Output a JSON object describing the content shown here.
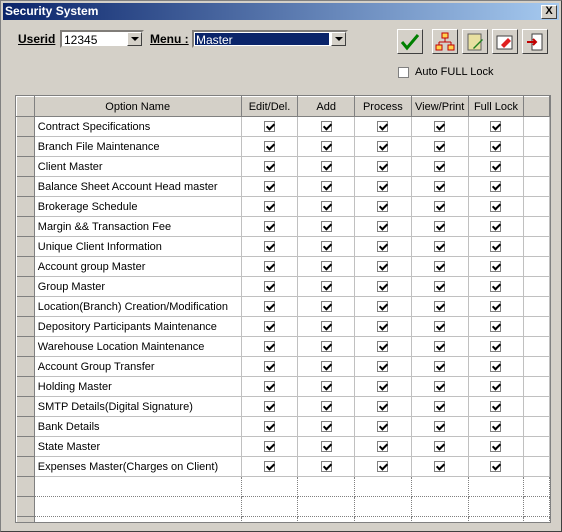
{
  "window": {
    "title": "Security System",
    "close_label": "X"
  },
  "form": {
    "userid_label": "Userid",
    "userid_value": "12345",
    "menu_label": "Menu :",
    "menu_value": "Master",
    "auto_full_lock_label": "Auto FULL Lock",
    "auto_full_lock_checked": false
  },
  "toolbar": {
    "buttons": [
      {
        "icon": "checkmark-icon"
      },
      {
        "icon": "hierarchy-icon"
      },
      {
        "icon": "edit-note-icon"
      },
      {
        "icon": "erase-icon"
      },
      {
        "icon": "exit-icon"
      }
    ]
  },
  "table": {
    "columns": [
      "Option Name",
      "Edit/Del.",
      "Add",
      "Process",
      "View/Print",
      "Full Lock"
    ],
    "rows": [
      {
        "name": "Contract Specifications",
        "edit": true,
        "add": true,
        "process": true,
        "view": true,
        "full": true
      },
      {
        "name": "Branch File Maintenance",
        "edit": true,
        "add": true,
        "process": true,
        "view": true,
        "full": true
      },
      {
        "name": "Client Master",
        "edit": true,
        "add": true,
        "process": true,
        "view": true,
        "full": true
      },
      {
        "name": "Balance Sheet Account Head master",
        "edit": true,
        "add": true,
        "process": true,
        "view": true,
        "full": true
      },
      {
        "name": "Brokerage Schedule",
        "edit": true,
        "add": true,
        "process": true,
        "view": true,
        "full": true
      },
      {
        "name": "Margin && Transaction Fee",
        "edit": true,
        "add": true,
        "process": true,
        "view": true,
        "full": true
      },
      {
        "name": "Unique Client Information",
        "edit": true,
        "add": true,
        "process": true,
        "view": true,
        "full": true
      },
      {
        "name": "Account group Master",
        "edit": true,
        "add": true,
        "process": true,
        "view": true,
        "full": true
      },
      {
        "name": "Group Master",
        "edit": true,
        "add": true,
        "process": true,
        "view": true,
        "full": true
      },
      {
        "name": "Location(Branch) Creation/Modification",
        "edit": true,
        "add": true,
        "process": true,
        "view": true,
        "full": true
      },
      {
        "name": "Depository Participants Maintenance",
        "edit": true,
        "add": true,
        "process": true,
        "view": true,
        "full": true
      },
      {
        "name": "Warehouse Location Maintenance",
        "edit": true,
        "add": true,
        "process": true,
        "view": true,
        "full": true
      },
      {
        "name": "Account Group Transfer",
        "edit": true,
        "add": true,
        "process": true,
        "view": true,
        "full": true
      },
      {
        "name": "Holding Master",
        "edit": true,
        "add": true,
        "process": true,
        "view": true,
        "full": true
      },
      {
        "name": "SMTP Details(Digital Signature)",
        "edit": true,
        "add": true,
        "process": true,
        "view": true,
        "full": true
      },
      {
        "name": "Bank Details",
        "edit": true,
        "add": true,
        "process": true,
        "view": true,
        "full": true
      },
      {
        "name": "State Master",
        "edit": true,
        "add": true,
        "process": true,
        "view": true,
        "full": true
      },
      {
        "name": "Expenses Master(Charges on Client)",
        "edit": true,
        "add": true,
        "process": true,
        "view": true,
        "full": true
      }
    ],
    "empty_rows": 3
  }
}
